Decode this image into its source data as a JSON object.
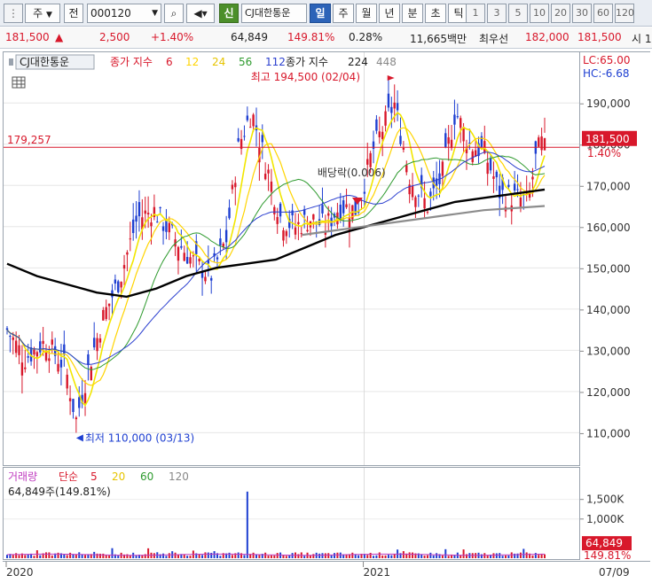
{
  "toolbar": {
    "market": "주",
    "market_icon": "dropdown-arrow",
    "mode": "전",
    "code": "000120",
    "badge_new": "신",
    "name": "CJ대한통운",
    "periods": [
      "일",
      "주",
      "월",
      "년",
      "분",
      "초",
      "틱"
    ],
    "active_period": "일",
    "intervals": [
      "1",
      "3",
      "5",
      "10",
      "20",
      "30",
      "60",
      "120"
    ]
  },
  "quote": {
    "price": "181,500",
    "change": "2,500",
    "change_pct": "+1.40%",
    "volume": "64,849",
    "volume_ratio": "149.81%",
    "turnover": "0.28%",
    "amount": "11,665백만",
    "best_label": "최우선",
    "best_ask": "182,000",
    "best_bid": "181,500",
    "tail": "시 1"
  },
  "colors": {
    "up": "#d8182b",
    "down": "#1e3fd1",
    "ma5": "#f2e600",
    "ma6": "#f2e600",
    "ma12": "#ffd400",
    "ma24": "#e6c400",
    "ma56": "#2e9a2e",
    "ma112": "#2b3fcf",
    "ma224": "#000000",
    "ma448": "#8c8c8c"
  },
  "legend": {
    "name": "CJ대한통운",
    "ma_label": "종가 지수",
    "ma_periods": [
      "6",
      "12",
      "24",
      "56",
      "112"
    ],
    "ma_label2": "종가 지수",
    "ma_periods2": [
      "224",
      "448"
    ]
  },
  "annotations": {
    "high": "최고 194,500 (02/04)",
    "low": "최저 110,000 (03/13)",
    "dividend": "배당락(0.006)",
    "ref_line_value": "179,257"
  },
  "right_panel": {
    "lc": "LC:65.00",
    "hc": "HC:-6.68",
    "current_price": "181,500",
    "current_pct": "1.40%"
  },
  "volume_legend": {
    "title": "거래량",
    "ma_label": "단순",
    "periods": [
      "5",
      "20",
      "60",
      "120"
    ],
    "current": "64,849주(149.81%)",
    "current_value": "64,849",
    "current_pct": "149.81%"
  },
  "date_axis": {
    "labels": [
      "2020",
      "2021"
    ],
    "current_date": "07/09"
  },
  "chart_data": {
    "type": "candlestick",
    "title": "",
    "y_price_ticks": [
      110000,
      120000,
      130000,
      140000,
      150000,
      160000,
      170000,
      180000,
      190000
    ],
    "y_price_tick_labels": [
      "110,000",
      "120,000",
      "130,000",
      "140,000",
      "150,000",
      "160,000",
      "170,000",
      "180,000",
      "190,000"
    ],
    "ylim": [
      103000,
      198000
    ],
    "reference_line": 179257,
    "high": {
      "date": "2021-02-04",
      "value": 194500
    },
    "low": {
      "date": "2020-03-13",
      "value": 110000
    },
    "last": 181500,
    "trend_points": [
      {
        "date": "2020-01-02",
        "close": 135000
      },
      {
        "date": "2020-01-20",
        "close": 128000
      },
      {
        "date": "2020-02-10",
        "close": 132000
      },
      {
        "date": "2020-03-02",
        "close": 126000
      },
      {
        "date": "2020-03-13",
        "close": 113000
      },
      {
        "date": "2020-03-25",
        "close": 125000
      },
      {
        "date": "2020-04-10",
        "close": 138000
      },
      {
        "date": "2020-04-28",
        "close": 148000
      },
      {
        "date": "2020-05-15",
        "close": 162000
      },
      {
        "date": "2020-06-01",
        "close": 164000
      },
      {
        "date": "2020-06-20",
        "close": 158000
      },
      {
        "date": "2020-07-10",
        "close": 152000
      },
      {
        "date": "2020-07-30",
        "close": 148000
      },
      {
        "date": "2020-08-15",
        "close": 157000
      },
      {
        "date": "2020-08-28",
        "close": 180000
      },
      {
        "date": "2020-09-10",
        "close": 188000
      },
      {
        "date": "2020-09-25",
        "close": 175000
      },
      {
        "date": "2020-10-10",
        "close": 162000
      },
      {
        "date": "2020-10-25",
        "close": 160000
      },
      {
        "date": "2020-11-10",
        "close": 162000
      },
      {
        "date": "2020-11-25",
        "close": 160000
      },
      {
        "date": "2020-12-10",
        "close": 165000
      },
      {
        "date": "2020-12-28",
        "close": 164000
      },
      {
        "date": "2021-01-12",
        "close": 178000
      },
      {
        "date": "2021-02-04",
        "close": 190000
      },
      {
        "date": "2021-02-20",
        "close": 172000
      },
      {
        "date": "2021-03-10",
        "close": 165000
      },
      {
        "date": "2021-03-25",
        "close": 172000
      },
      {
        "date": "2021-04-08",
        "close": 188000
      },
      {
        "date": "2021-04-22",
        "close": 180000
      },
      {
        "date": "2021-05-08",
        "close": 178000
      },
      {
        "date": "2021-05-24",
        "close": 168000
      },
      {
        "date": "2021-06-10",
        "close": 167000
      },
      {
        "date": "2021-06-22",
        "close": 166000
      },
      {
        "date": "2021-07-01",
        "close": 178000
      },
      {
        "date": "2021-07-09",
        "close": 181500
      }
    ],
    "series": [
      {
        "name": "종가 지수 224",
        "values": [
          151000,
          148000,
          146000,
          144000,
          143000,
          145000,
          148000,
          150000,
          151000,
          152000,
          155000,
          158000,
          160000,
          162000,
          164000,
          166000,
          167000,
          168000,
          169000
        ]
      },
      {
        "name": "종가 지수 448",
        "values": [
          158000,
          159000,
          160000,
          161000,
          162000,
          163000,
          164000,
          164500,
          165000
        ]
      }
    ],
    "volume": {
      "y_ticks": [
        1000000,
        1500000
      ],
      "y_tick_labels": [
        "1,000K",
        "1,500K"
      ],
      "ylim": [
        0,
        1900000
      ],
      "current": 64849,
      "spike": {
        "date": "2020-09-05",
        "value": 1700000
      }
    }
  }
}
